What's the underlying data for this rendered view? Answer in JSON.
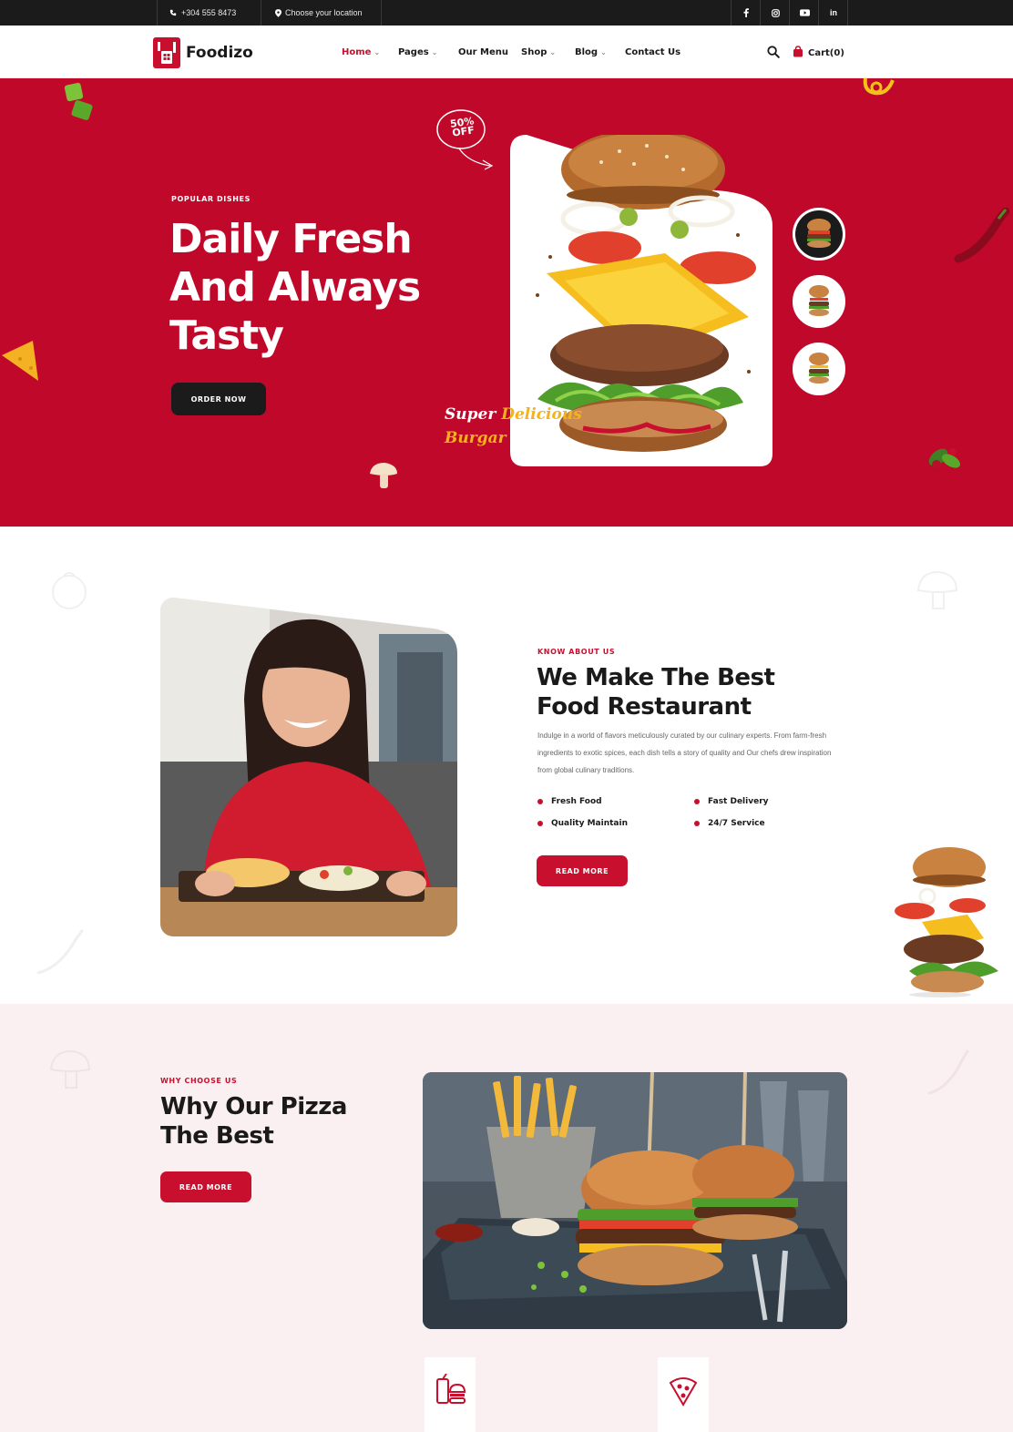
{
  "topbar": {
    "phone": "+304 555 8473",
    "location": "Choose your location",
    "social": [
      "f",
      "ig",
      "yt",
      "in"
    ]
  },
  "header": {
    "logo_text": "Foodizo",
    "nav": [
      {
        "label": "Home",
        "has_dropdown": true,
        "active": true
      },
      {
        "label": "Pages",
        "has_dropdown": true,
        "active": false
      },
      {
        "label": "Our Menu",
        "has_dropdown": false,
        "active": false
      },
      {
        "label": "Shop",
        "has_dropdown": true,
        "active": false
      },
      {
        "label": "Blog",
        "has_dropdown": true,
        "active": false
      },
      {
        "label": "Contact Us",
        "has_dropdown": false,
        "active": false
      }
    ],
    "cart_label": "Cart(0)"
  },
  "hero": {
    "eyebrow": "POPULAR DISHES",
    "title_line1": "Daily Fresh",
    "title_line2": "And Always",
    "title_line3": "Tasty",
    "cta": "ORDER NOW",
    "badge": "50% OFF",
    "script_line1a": "Super ",
    "script_line1b": "Delicious",
    "script_line2": "Burgar"
  },
  "about": {
    "eyebrow": "KNOW ABOUT US",
    "title_line1": "We Make The Best",
    "title_line2": "Food Restaurant",
    "description": "Indulge in a world of flavors meticulously curated by our culinary experts. From farm-fresh ingredients to exotic spices, each dish tells a story of quality and Our chefs drew inspiration from global culinary traditions.",
    "features": [
      "Fresh Food",
      "Fast Delivery",
      "Quality Maintain",
      "24/7 Service"
    ],
    "cta": "READ MORE"
  },
  "why": {
    "eyebrow": "WHY CHOOSE US",
    "title_line1": "Why Our Pizza",
    "title_line2": "The Best",
    "cta": "READ MORE"
  },
  "icons": {
    "phone": "phone-icon",
    "location": "location-pin-icon",
    "search": "search-icon",
    "cart": "shopping-bag-icon",
    "service1": "burger-drink-icon",
    "service2": "pizza-slice-icon"
  },
  "colors": {
    "brand_red": "#c8102e",
    "hero_red": "#c0092a",
    "dark": "#1b1b1b",
    "accent_yellow": "#f6b21b",
    "why_bg": "#fbf0f1"
  }
}
